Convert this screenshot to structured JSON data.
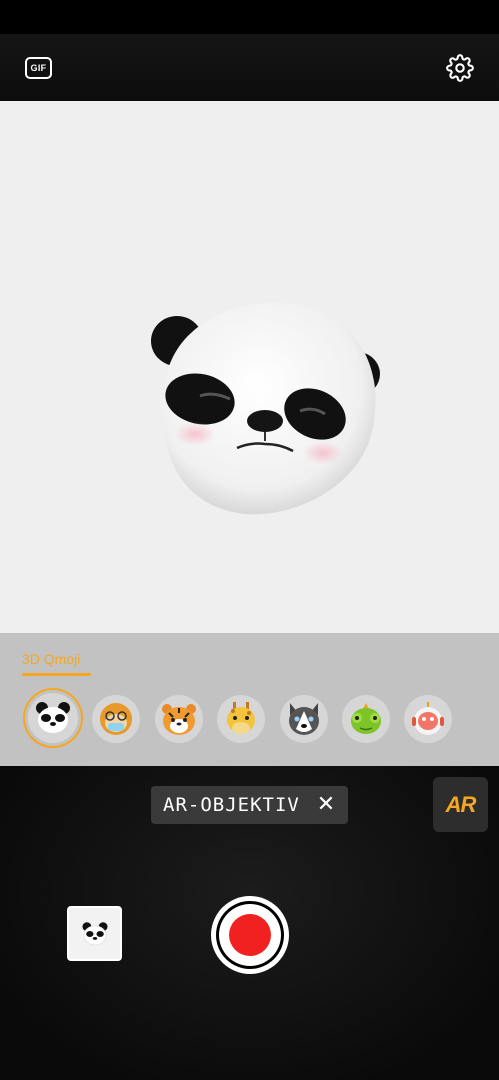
{
  "top_bar": {
    "gif_label": "GIF",
    "settings_icon": "gear-icon"
  },
  "qmoji": {
    "tab_label": "3D Qmoji",
    "accent_color": "#f5a623",
    "items": [
      {
        "name": "panda",
        "selected": true
      },
      {
        "name": "monkey",
        "selected": false
      },
      {
        "name": "tiger",
        "selected": false
      },
      {
        "name": "giraffe",
        "selected": false
      },
      {
        "name": "husky",
        "selected": false
      },
      {
        "name": "chameleon",
        "selected": false
      },
      {
        "name": "robot",
        "selected": false
      }
    ]
  },
  "ar": {
    "chip_label": "AR-OBJEKTIV",
    "close_symbol": "✕",
    "logo_text": "AR"
  },
  "capture": {
    "record_color": "#f22121"
  }
}
